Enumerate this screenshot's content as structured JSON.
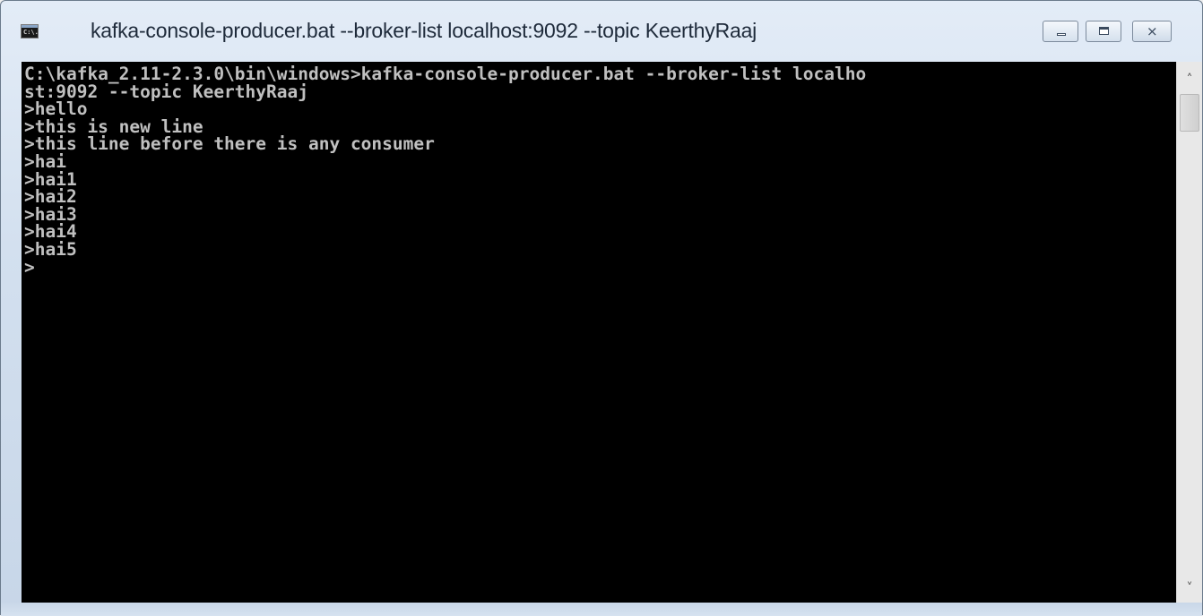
{
  "window": {
    "title": "kafka-console-producer.bat  --broker-list localhost:9092 --topic KeerthyRaaj",
    "icon_text": "C:\\.",
    "controls": {
      "minimize": "minimize-icon",
      "maximize": "maximize-icon",
      "close": "close-icon",
      "close_glyph": "⨯"
    }
  },
  "console": {
    "lines": [
      "C:\\kafka_2.11-2.3.0\\bin\\windows>kafka-console-producer.bat --broker-list localho",
      "st:9092 --topic KeerthyRaaj",
      ">hello",
      ">this is new line",
      ">this line before there is any consumer",
      ">hai",
      ">hai1",
      ">hai2",
      ">hai3",
      ">hai4",
      ">hai5",
      ">"
    ],
    "background_color": "#000000",
    "text_color": "#c0c0c0"
  },
  "scrollbar": {
    "up_arrow": "˄",
    "down_arrow": "˅"
  }
}
